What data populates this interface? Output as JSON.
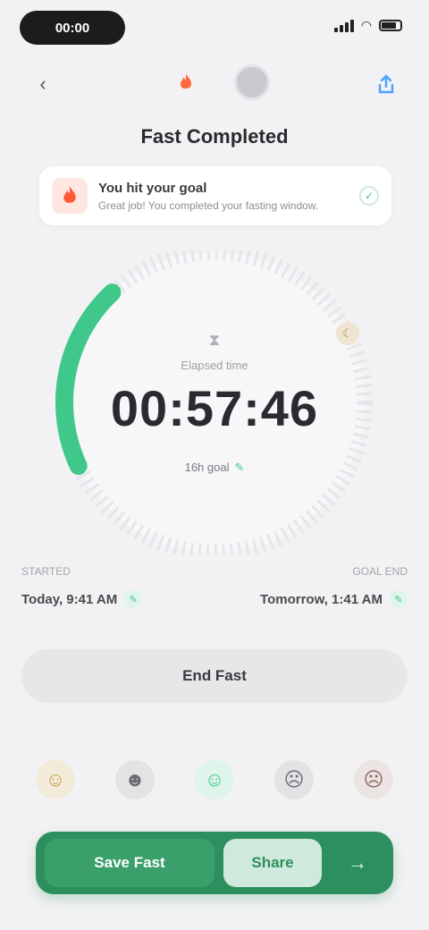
{
  "status_bar": {
    "time": "00:00"
  },
  "nav": {
    "back_icon": "chevron-left-icon",
    "fire_icon": "fire-icon",
    "share_icon": "share-icon"
  },
  "header": {
    "title": "Fast Completed"
  },
  "banner": {
    "icon": "flame-icon",
    "title": "You hit your goal",
    "subtitle": "Great job! You completed your fasting window.",
    "check_icon": "check-icon"
  },
  "timer": {
    "label": "Elapsed time",
    "value": "00:57:46",
    "sub_label": "16h goal",
    "progress_fraction": 0.2,
    "colors": {
      "accent": "#40c88a",
      "track": "#e6e6ea"
    }
  },
  "times": {
    "start_caption": "STARTED",
    "start_value": "Today, 9:41 AM",
    "end_caption": "GOAL END",
    "end_value": "Tomorrow, 1:41 AM"
  },
  "secondary_button": {
    "label": "End Fast"
  },
  "moods": [
    {
      "name": "mood-happy-icon",
      "glyph": "☺",
      "bg": "#f3ebd9",
      "color": "#c4a14a"
    },
    {
      "name": "mood-neutral-icon",
      "glyph": "☻",
      "bg": "#e3e3e6",
      "color": "#6b6b70"
    },
    {
      "name": "mood-calm-icon",
      "glyph": "☺",
      "bg": "#dff4ea",
      "color": "#40c88a"
    },
    {
      "name": "mood-tired-icon",
      "glyph": "☹",
      "bg": "#e3e3e6",
      "color": "#6b6b70"
    },
    {
      "name": "mood-sad-icon",
      "glyph": "☹",
      "bg": "#ece4e2",
      "color": "#8a6a64"
    }
  ],
  "cta": {
    "primary_label": "Save Fast",
    "secondary_label": "Share",
    "icon": "arrow-right-icon"
  },
  "colors": {
    "brand_green": "#2e8f5e",
    "accent_green": "#40c88a",
    "background": "#f2f2f4"
  }
}
